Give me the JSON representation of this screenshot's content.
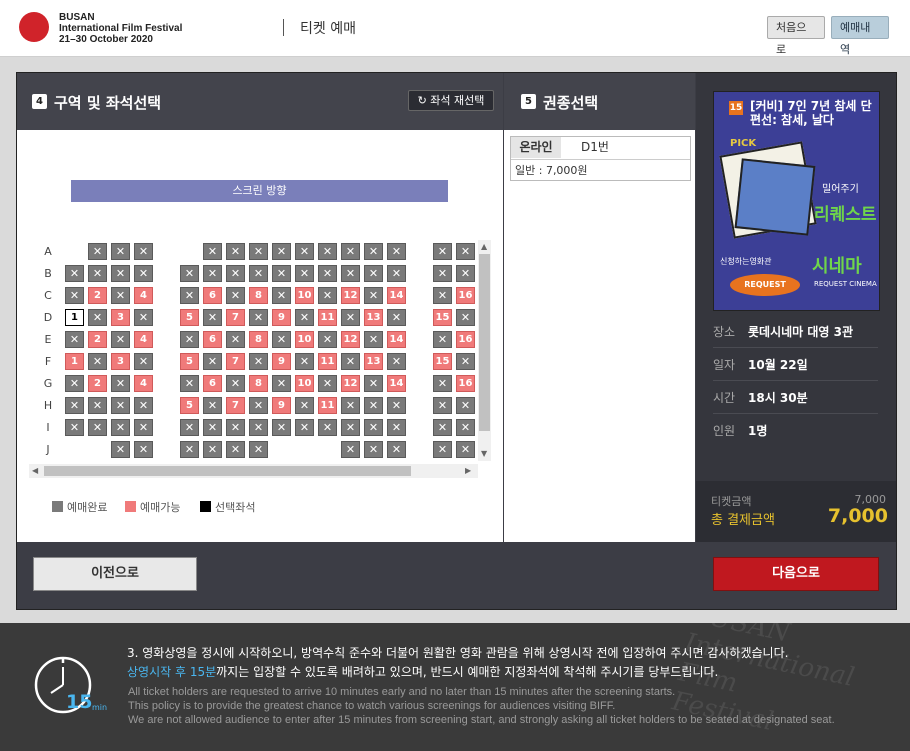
{
  "header": {
    "logo_lines": [
      "BUSAN",
      "International Film Festival",
      "21–30 October 2020"
    ],
    "title": "티켓 예매",
    "btn_first": "처음으로",
    "btn_history": "예매내역"
  },
  "seat_section": {
    "step": "4",
    "title": "구역 및 좌석선택",
    "reselect": "좌석 재선택",
    "screen_label": "스크린 방향",
    "rows": [
      "A",
      "B",
      "C",
      "D",
      "E",
      "F",
      "G",
      "H",
      "I",
      "J"
    ],
    "sold_mark": "✕",
    "seats": [
      {
        "r": 0,
        "c": 2,
        "s": "sold"
      },
      {
        "r": 0,
        "c": 3,
        "s": "sold"
      },
      {
        "r": 0,
        "c": 4,
        "s": "sold"
      },
      {
        "r": 0,
        "c": 6,
        "s": "sold"
      },
      {
        "r": 0,
        "c": 7,
        "s": "sold"
      },
      {
        "r": 0,
        "c": 8,
        "s": "sold"
      },
      {
        "r": 0,
        "c": 9,
        "s": "sold"
      },
      {
        "r": 0,
        "c": 10,
        "s": "sold"
      },
      {
        "r": 0,
        "c": 11,
        "s": "sold"
      },
      {
        "r": 0,
        "c": 12,
        "s": "sold"
      },
      {
        "r": 0,
        "c": 13,
        "s": "sold"
      },
      {
        "r": 0,
        "c": 14,
        "s": "sold"
      },
      {
        "r": 0,
        "c": 15,
        "s": "sold"
      },
      {
        "r": 0,
        "c": 16,
        "s": "sold"
      },
      {
        "r": 1,
        "c": 1,
        "s": "sold"
      },
      {
        "r": 1,
        "c": 2,
        "s": "sold"
      },
      {
        "r": 1,
        "c": 3,
        "s": "sold"
      },
      {
        "r": 1,
        "c": 4,
        "s": "sold"
      },
      {
        "r": 1,
        "c": 5,
        "s": "sold"
      },
      {
        "r": 1,
        "c": 6,
        "s": "sold"
      },
      {
        "r": 1,
        "c": 7,
        "s": "sold"
      },
      {
        "r": 1,
        "c": 8,
        "s": "sold"
      },
      {
        "r": 1,
        "c": 9,
        "s": "sold"
      },
      {
        "r": 1,
        "c": 10,
        "s": "sold"
      },
      {
        "r": 1,
        "c": 11,
        "s": "sold"
      },
      {
        "r": 1,
        "c": 12,
        "s": "sold"
      },
      {
        "r": 1,
        "c": 13,
        "s": "sold"
      },
      {
        "r": 1,
        "c": 14,
        "s": "sold"
      },
      {
        "r": 1,
        "c": 15,
        "s": "sold"
      },
      {
        "r": 1,
        "c": 16,
        "s": "sold"
      },
      {
        "r": 2,
        "c": 1,
        "s": "sold"
      },
      {
        "r": 2,
        "c": 2,
        "s": "avail",
        "n": "2"
      },
      {
        "r": 2,
        "c": 3,
        "s": "sold"
      },
      {
        "r": 2,
        "c": 4,
        "s": "avail",
        "n": "4"
      },
      {
        "r": 2,
        "c": 5,
        "s": "sold"
      },
      {
        "r": 2,
        "c": 6,
        "s": "avail",
        "n": "6"
      },
      {
        "r": 2,
        "c": 7,
        "s": "sold"
      },
      {
        "r": 2,
        "c": 8,
        "s": "avail",
        "n": "8"
      },
      {
        "r": 2,
        "c": 9,
        "s": "sold"
      },
      {
        "r": 2,
        "c": 10,
        "s": "avail",
        "n": "10"
      },
      {
        "r": 2,
        "c": 11,
        "s": "sold"
      },
      {
        "r": 2,
        "c": 12,
        "s": "avail",
        "n": "12"
      },
      {
        "r": 2,
        "c": 13,
        "s": "sold"
      },
      {
        "r": 2,
        "c": 14,
        "s": "avail",
        "n": "14"
      },
      {
        "r": 2,
        "c": 15,
        "s": "sold"
      },
      {
        "r": 2,
        "c": 16,
        "s": "avail",
        "n": "16"
      },
      {
        "r": 3,
        "c": 1,
        "s": "selected",
        "n": "1"
      },
      {
        "r": 3,
        "c": 2,
        "s": "sold"
      },
      {
        "r": 3,
        "c": 3,
        "s": "avail",
        "n": "3"
      },
      {
        "r": 3,
        "c": 4,
        "s": "sold"
      },
      {
        "r": 3,
        "c": 5,
        "s": "avail",
        "n": "5"
      },
      {
        "r": 3,
        "c": 6,
        "s": "sold"
      },
      {
        "r": 3,
        "c": 7,
        "s": "avail",
        "n": "7"
      },
      {
        "r": 3,
        "c": 8,
        "s": "sold"
      },
      {
        "r": 3,
        "c": 9,
        "s": "avail",
        "n": "9"
      },
      {
        "r": 3,
        "c": 10,
        "s": "sold"
      },
      {
        "r": 3,
        "c": 11,
        "s": "avail",
        "n": "11"
      },
      {
        "r": 3,
        "c": 12,
        "s": "sold"
      },
      {
        "r": 3,
        "c": 13,
        "s": "avail",
        "n": "13"
      },
      {
        "r": 3,
        "c": 14,
        "s": "sold"
      },
      {
        "r": 3,
        "c": 15,
        "s": "avail",
        "n": "15"
      },
      {
        "r": 3,
        "c": 16,
        "s": "sold"
      },
      {
        "r": 4,
        "c": 1,
        "s": "sold"
      },
      {
        "r": 4,
        "c": 2,
        "s": "avail",
        "n": "2"
      },
      {
        "r": 4,
        "c": 3,
        "s": "sold"
      },
      {
        "r": 4,
        "c": 4,
        "s": "avail",
        "n": "4"
      },
      {
        "r": 4,
        "c": 5,
        "s": "sold"
      },
      {
        "r": 4,
        "c": 6,
        "s": "avail",
        "n": "6"
      },
      {
        "r": 4,
        "c": 7,
        "s": "sold"
      },
      {
        "r": 4,
        "c": 8,
        "s": "avail",
        "n": "8"
      },
      {
        "r": 4,
        "c": 9,
        "s": "sold"
      },
      {
        "r": 4,
        "c": 10,
        "s": "avail",
        "n": "10"
      },
      {
        "r": 4,
        "c": 11,
        "s": "sold"
      },
      {
        "r": 4,
        "c": 12,
        "s": "avail",
        "n": "12"
      },
      {
        "r": 4,
        "c": 13,
        "s": "sold"
      },
      {
        "r": 4,
        "c": 14,
        "s": "avail",
        "n": "14"
      },
      {
        "r": 4,
        "c": 15,
        "s": "sold"
      },
      {
        "r": 4,
        "c": 16,
        "s": "avail",
        "n": "16"
      },
      {
        "r": 5,
        "c": 1,
        "s": "avail",
        "n": "1"
      },
      {
        "r": 5,
        "c": 2,
        "s": "sold"
      },
      {
        "r": 5,
        "c": 3,
        "s": "avail",
        "n": "3"
      },
      {
        "r": 5,
        "c": 4,
        "s": "sold"
      },
      {
        "r": 5,
        "c": 5,
        "s": "avail",
        "n": "5"
      },
      {
        "r": 5,
        "c": 6,
        "s": "sold"
      },
      {
        "r": 5,
        "c": 7,
        "s": "avail",
        "n": "7"
      },
      {
        "r": 5,
        "c": 8,
        "s": "sold"
      },
      {
        "r": 5,
        "c": 9,
        "s": "avail",
        "n": "9"
      },
      {
        "r": 5,
        "c": 10,
        "s": "sold"
      },
      {
        "r": 5,
        "c": 11,
        "s": "avail",
        "n": "11"
      },
      {
        "r": 5,
        "c": 12,
        "s": "sold"
      },
      {
        "r": 5,
        "c": 13,
        "s": "avail",
        "n": "13"
      },
      {
        "r": 5,
        "c": 14,
        "s": "sold"
      },
      {
        "r": 5,
        "c": 15,
        "s": "avail",
        "n": "15"
      },
      {
        "r": 5,
        "c": 16,
        "s": "sold"
      },
      {
        "r": 6,
        "c": 1,
        "s": "sold"
      },
      {
        "r": 6,
        "c": 2,
        "s": "avail",
        "n": "2"
      },
      {
        "r": 6,
        "c": 3,
        "s": "sold"
      },
      {
        "r": 6,
        "c": 4,
        "s": "avail",
        "n": "4"
      },
      {
        "r": 6,
        "c": 5,
        "s": "sold"
      },
      {
        "r": 6,
        "c": 6,
        "s": "avail",
        "n": "6"
      },
      {
        "r": 6,
        "c": 7,
        "s": "sold"
      },
      {
        "r": 6,
        "c": 8,
        "s": "avail",
        "n": "8"
      },
      {
        "r": 6,
        "c": 9,
        "s": "sold"
      },
      {
        "r": 6,
        "c": 10,
        "s": "avail",
        "n": "10"
      },
      {
        "r": 6,
        "c": 11,
        "s": "sold"
      },
      {
        "r": 6,
        "c": 12,
        "s": "avail",
        "n": "12"
      },
      {
        "r": 6,
        "c": 13,
        "s": "sold"
      },
      {
        "r": 6,
        "c": 14,
        "s": "avail",
        "n": "14"
      },
      {
        "r": 6,
        "c": 15,
        "s": "sold"
      },
      {
        "r": 6,
        "c": 16,
        "s": "avail",
        "n": "16"
      },
      {
        "r": 7,
        "c": 1,
        "s": "sold"
      },
      {
        "r": 7,
        "c": 2,
        "s": "sold"
      },
      {
        "r": 7,
        "c": 3,
        "s": "sold"
      },
      {
        "r": 7,
        "c": 4,
        "s": "sold"
      },
      {
        "r": 7,
        "c": 5,
        "s": "avail",
        "n": "5"
      },
      {
        "r": 7,
        "c": 6,
        "s": "sold"
      },
      {
        "r": 7,
        "c": 7,
        "s": "avail",
        "n": "7"
      },
      {
        "r": 7,
        "c": 8,
        "s": "sold"
      },
      {
        "r": 7,
        "c": 9,
        "s": "avail",
        "n": "9"
      },
      {
        "r": 7,
        "c": 10,
        "s": "sold"
      },
      {
        "r": 7,
        "c": 11,
        "s": "avail",
        "n": "11"
      },
      {
        "r": 7,
        "c": 12,
        "s": "sold"
      },
      {
        "r": 7,
        "c": 13,
        "s": "sold"
      },
      {
        "r": 7,
        "c": 14,
        "s": "sold"
      },
      {
        "r": 7,
        "c": 15,
        "s": "sold"
      },
      {
        "r": 7,
        "c": 16,
        "s": "sold"
      },
      {
        "r": 8,
        "c": 1,
        "s": "sold"
      },
      {
        "r": 8,
        "c": 2,
        "s": "sold"
      },
      {
        "r": 8,
        "c": 3,
        "s": "sold"
      },
      {
        "r": 8,
        "c": 4,
        "s": "sold"
      },
      {
        "r": 8,
        "c": 5,
        "s": "sold"
      },
      {
        "r": 8,
        "c": 6,
        "s": "sold"
      },
      {
        "r": 8,
        "c": 7,
        "s": "sold"
      },
      {
        "r": 8,
        "c": 8,
        "s": "sold"
      },
      {
        "r": 8,
        "c": 9,
        "s": "sold"
      },
      {
        "r": 8,
        "c": 10,
        "s": "sold"
      },
      {
        "r": 8,
        "c": 11,
        "s": "sold"
      },
      {
        "r": 8,
        "c": 12,
        "s": "sold"
      },
      {
        "r": 8,
        "c": 13,
        "s": "sold"
      },
      {
        "r": 8,
        "c": 14,
        "s": "sold"
      },
      {
        "r": 8,
        "c": 15,
        "s": "sold"
      },
      {
        "r": 8,
        "c": 16,
        "s": "sold"
      },
      {
        "r": 9,
        "c": 3,
        "s": "sold"
      },
      {
        "r": 9,
        "c": 4,
        "s": "sold"
      },
      {
        "r": 9,
        "c": 5,
        "s": "sold"
      },
      {
        "r": 9,
        "c": 6,
        "s": "sold"
      },
      {
        "r": 9,
        "c": 7,
        "s": "sold"
      },
      {
        "r": 9,
        "c": 8,
        "s": "sold"
      },
      {
        "r": 9,
        "c": 12,
        "s": "sold"
      },
      {
        "r": 9,
        "c": 13,
        "s": "sold"
      },
      {
        "r": 9,
        "c": 14,
        "s": "sold"
      },
      {
        "r": 9,
        "c": 15,
        "s": "sold"
      },
      {
        "r": 9,
        "c": 16,
        "s": "sold"
      }
    ],
    "legend": [
      {
        "label": "예매완료",
        "color": "#7a7a7a"
      },
      {
        "label": "예매가능",
        "color": "#f07a7a"
      },
      {
        "label": "선택좌석",
        "color": "#000000"
      }
    ]
  },
  "ticket_section": {
    "step": "5",
    "title": "권종선택",
    "type_tag": "온라인",
    "seat": "D1번",
    "price_line": "일반 : 7,000원"
  },
  "movie": {
    "rating": "15",
    "title": "[커비] 7인 7년 참세 단편선: 참세, 날다",
    "poster_lines": [
      "PICK",
      "밀어주기",
      "리퀘스트",
      "시네마",
      "신청하는영화관",
      "REQUEST",
      "REQUEST CINEMA"
    ],
    "info": [
      {
        "key": "장소",
        "value": "롯데시네마 대영 3관"
      },
      {
        "key": "일자",
        "value": "10월 22일"
      },
      {
        "key": "시간",
        "value": "18시 30분"
      },
      {
        "key": "인원",
        "value": "1명"
      }
    ],
    "ticket_price_label": "티켓금액",
    "ticket_price": "7,000",
    "total_label": "총 결제금액",
    "total": "7,000"
  },
  "nav": {
    "prev": "이전으로",
    "next": "다음으로"
  },
  "footer": {
    "minutes": "15",
    "unit": "min",
    "kr_line1": "3. 영화상영을 정시에 시작하오니, 방역수칙 준수와 더불어 원활한 영화 관람을 위해 상영시작 전에 입장하여 주시면 감사하겠습니다.",
    "kr_highlight": "상영시작 후 15분",
    "kr_line2": "까지는 입장할 수 있도록 배려하고 있으며, 반드시 예매한 지정좌석에 착석해 주시기를 당부드립니다.",
    "en_lines": [
      "All ticket holders are requested to arrive 10 minutes early and no later than 15 minutes after the screening starts.",
      "This policy is to provide the greatest chance to watch various screenings for audiences visiting BIFF.",
      "We are not allowed audience to enter after 15 minutes from screening start, and strongly asking all ticket holders to be seated at designated seat."
    ],
    "watermark": [
      "BUSAN",
      "International",
      "Film",
      "Festival"
    ]
  }
}
